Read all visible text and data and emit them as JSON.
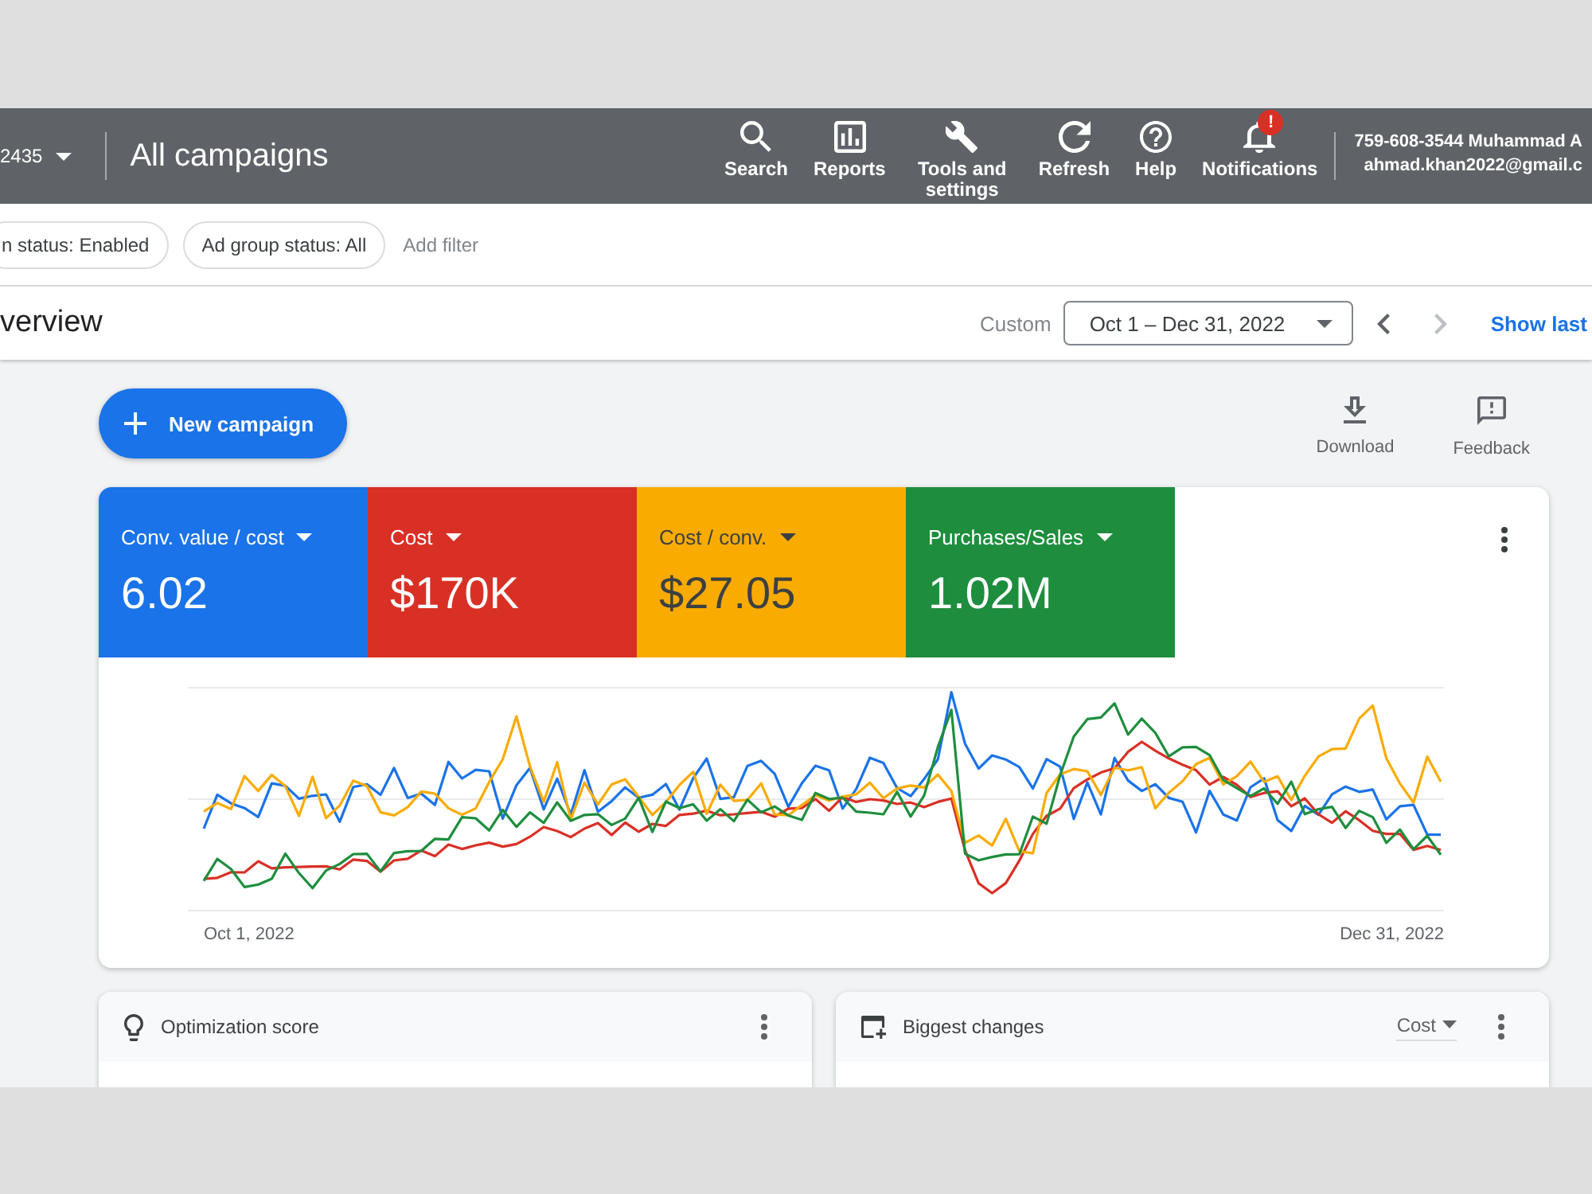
{
  "top_bar": {
    "account_id": "2435",
    "title": "All campaigns",
    "nav": [
      {
        "kind": "search",
        "label": "Search"
      },
      {
        "kind": "reports",
        "label": "Reports"
      },
      {
        "kind": "tools",
        "label": "Tools and settings"
      },
      {
        "kind": "refresh",
        "label": "Refresh"
      },
      {
        "kind": "help",
        "label": "Help"
      },
      {
        "kind": "notifications",
        "label": "Notifications",
        "badge": "!"
      }
    ],
    "account": {
      "name": "759-608-3544 Muhammad A",
      "email": "ahmad.khan2022@gmail.c"
    }
  },
  "filters": {
    "chips": [
      "n status: Enabled",
      "Ad group status: All"
    ],
    "add_filter": "Add filter"
  },
  "overview": {
    "title": "verview",
    "range_label": "Custom",
    "date_range": "Oct 1 – Dec 31, 2022",
    "pager": [
      {
        "kind": "previous",
        "disabled": false
      },
      {
        "kind": "next",
        "disabled": true
      }
    ],
    "show_last": "Show last"
  },
  "actions": {
    "new_campaign": "New campaign",
    "tools": [
      {
        "kind": "download",
        "label": "Download"
      },
      {
        "kind": "feedback",
        "label": "Feedback"
      }
    ]
  },
  "scorecards": [
    {
      "label": "Conv. value / cost",
      "value": "6.02",
      "color": "#1a73e8"
    },
    {
      "label": "Cost",
      "value": "$170K",
      "color": "#d93025"
    },
    {
      "label": "Cost / conv.",
      "value": "$27.05",
      "color": "#f9ab00"
    },
    {
      "label": "Purchases/Sales",
      "value": "1.02M",
      "color": "#1e8e3e"
    }
  ],
  "chart": {
    "start_label": "Oct 1, 2022",
    "end_label": "Dec 31, 2022"
  },
  "cards": [
    {
      "kind": "optimization",
      "title": "Optimization score"
    },
    {
      "kind": "changes",
      "title": "Biggest changes",
      "dropdown": "Cost"
    }
  ]
}
